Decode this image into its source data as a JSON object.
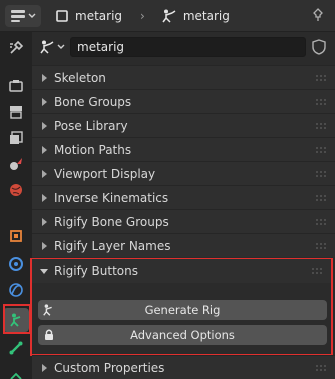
{
  "header": {
    "editor_icon": "properties-icon",
    "object_name": "metarig",
    "data_name": "metarig"
  },
  "object_row": {
    "type_icon": "armature-icon",
    "name_value": "metarig"
  },
  "panels": [
    {
      "label": "Skeleton",
      "expanded": false
    },
    {
      "label": "Bone Groups",
      "expanded": false
    },
    {
      "label": "Pose Library",
      "expanded": false
    },
    {
      "label": "Motion Paths",
      "expanded": false
    },
    {
      "label": "Viewport Display",
      "expanded": false
    },
    {
      "label": "Inverse Kinematics",
      "expanded": false
    },
    {
      "label": "Rigify Bone Groups",
      "expanded": false
    },
    {
      "label": "Rigify Layer Names",
      "expanded": false
    },
    {
      "label": "Rigify Buttons",
      "expanded": true
    },
    {
      "label": "Custom Properties",
      "expanded": false
    }
  ],
  "rigify_buttons": {
    "generate_label": "Generate Rig",
    "advanced_label": "Advanced Options"
  },
  "tabs": [
    "tool-icon",
    "render-icon",
    "output-icon",
    "view-layer-icon",
    "scene-icon",
    "world-icon",
    "object-icon",
    "modifiers-icon",
    "physics-icon",
    "object-data-armature-icon",
    "bone-icon",
    "bone-constraint-icon"
  ],
  "colors": {
    "highlight": "#e0302e",
    "active_tab_green": "#33c27a"
  }
}
